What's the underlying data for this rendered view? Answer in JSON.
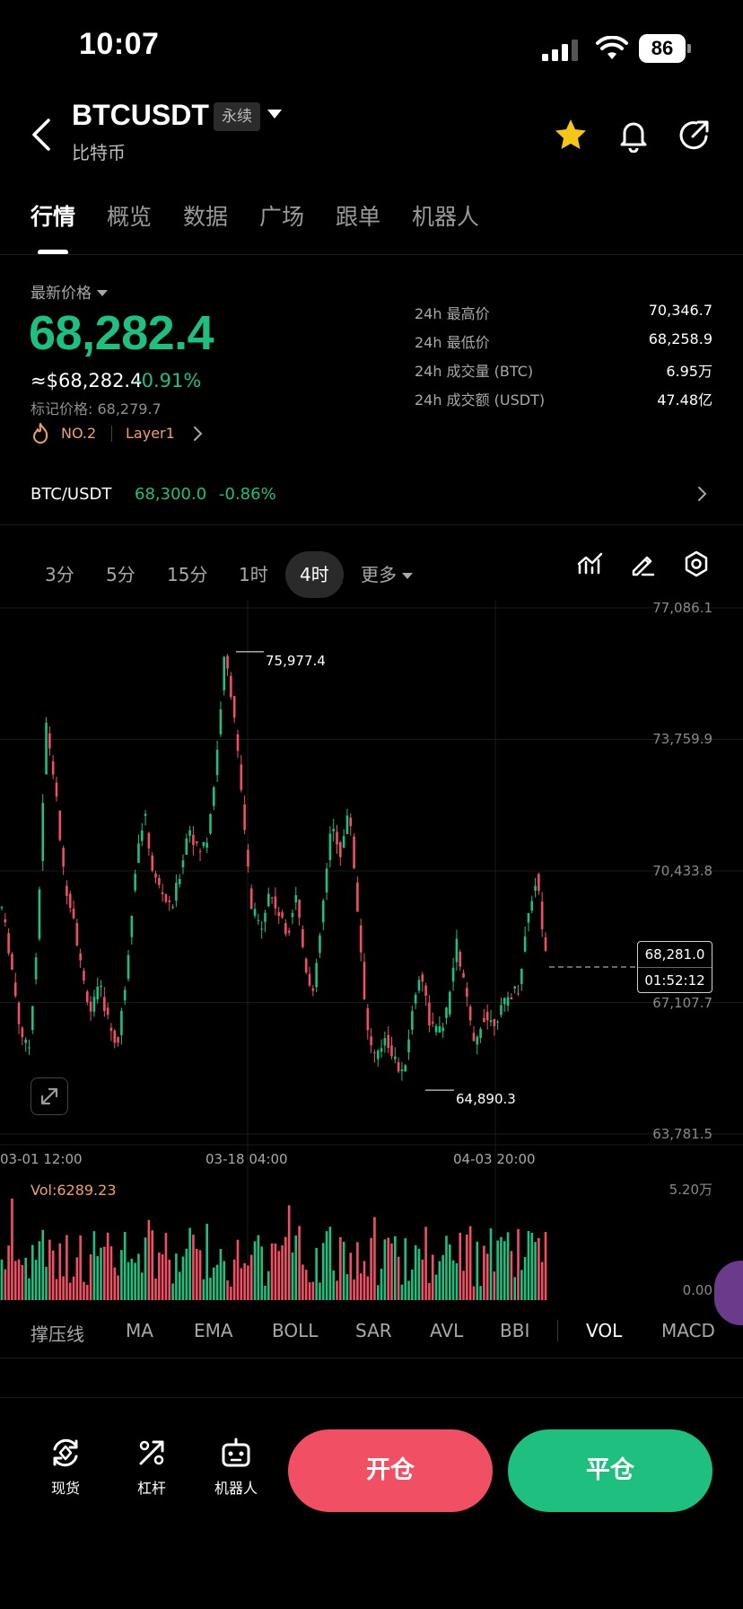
{
  "status_bar": {
    "time": "10:07",
    "battery": "86"
  },
  "header": {
    "title": "BTCUSDT",
    "badge": "永续",
    "subtitle": "比特币"
  },
  "tabs": [
    {
      "label": "行情",
      "active": true
    },
    {
      "label": "概览"
    },
    {
      "label": "数据"
    },
    {
      "label": "广场"
    },
    {
      "label": "跟单"
    },
    {
      "label": "机器人"
    }
  ],
  "price": {
    "label": "最新价格",
    "last": "68,282.4",
    "usd": "≈$68,282.4",
    "change": "-0.91%",
    "mark": "标记价格: 68,279.7",
    "rank": "NO.2",
    "tag": "Layer1",
    "up_color": "#1fbf7f",
    "down_color": "#f04f64"
  },
  "stats": [
    {
      "label": "24h 最高价",
      "value": "70,346.7"
    },
    {
      "label": "24h 最低价",
      "value": "68,258.9"
    },
    {
      "label": "24h 成交量 (BTC)",
      "value": "6.95万"
    },
    {
      "label": "24h 成交额 (USDT)",
      "value": "47.48亿"
    }
  ],
  "spot": {
    "pair": "BTC/USDT",
    "price": "68,300.0",
    "change": "-0.86%"
  },
  "intervals": [
    {
      "label": "3分"
    },
    {
      "label": "5分"
    },
    {
      "label": "15分"
    },
    {
      "label": "1时"
    },
    {
      "label": "4时",
      "active": true
    },
    {
      "label": "更多"
    }
  ],
  "chart_data": {
    "type": "candlestick",
    "y_ticks": [
      "77,086.1",
      "73,759.9",
      "70,433.8",
      "67,107.7",
      "63,781.5"
    ],
    "ylim": [
      63781.5,
      77086.1
    ],
    "x_ticks": [
      "03-01 12:00",
      "03-18 04:00",
      "04-03 20:00"
    ],
    "high_marker": "75,977.4",
    "low_marker": "64,890.3",
    "current": {
      "price": "68,281.0",
      "countdown": "01:52:12"
    },
    "path": [
      69500,
      68200,
      66500,
      65800,
      68800,
      74200,
      72500,
      70200,
      69400,
      67800,
      66900,
      67500,
      66600,
      66000,
      67900,
      70600,
      71900,
      70300,
      69900,
      69400,
      70400,
      71600,
      70900,
      71200,
      73000,
      75900,
      74600,
      72000,
      69500,
      69000,
      69900,
      69400,
      68800,
      69900,
      68100,
      67300,
      69500,
      71600,
      70900,
      72000,
      69200,
      66400,
      65600,
      66300,
      65700,
      65200,
      66800,
      68000,
      66600,
      66300,
      66900,
      68600,
      67400,
      65900,
      66800,
      66600,
      66900,
      67300,
      67500,
      69300,
      70300,
      68300
    ]
  },
  "volume": {
    "label": "Vol:6289.23",
    "max_tick": "5.20万",
    "min_tick": "0.00"
  },
  "indicators": [
    {
      "label": "撑压线"
    },
    {
      "label": "MA"
    },
    {
      "label": "EMA"
    },
    {
      "label": "BOLL"
    },
    {
      "label": "SAR"
    },
    {
      "label": "AVL"
    },
    {
      "label": "BBI"
    },
    {
      "label": "VOL",
      "active": true
    },
    {
      "label": "MACD"
    }
  ],
  "bottom_nav": [
    {
      "label": "现货",
      "icon": "spot-icon"
    },
    {
      "label": "杠杆",
      "icon": "leverage-icon"
    },
    {
      "label": "机器人",
      "icon": "robot-icon"
    }
  ],
  "actions": {
    "open": "开仓",
    "close": "平仓"
  }
}
